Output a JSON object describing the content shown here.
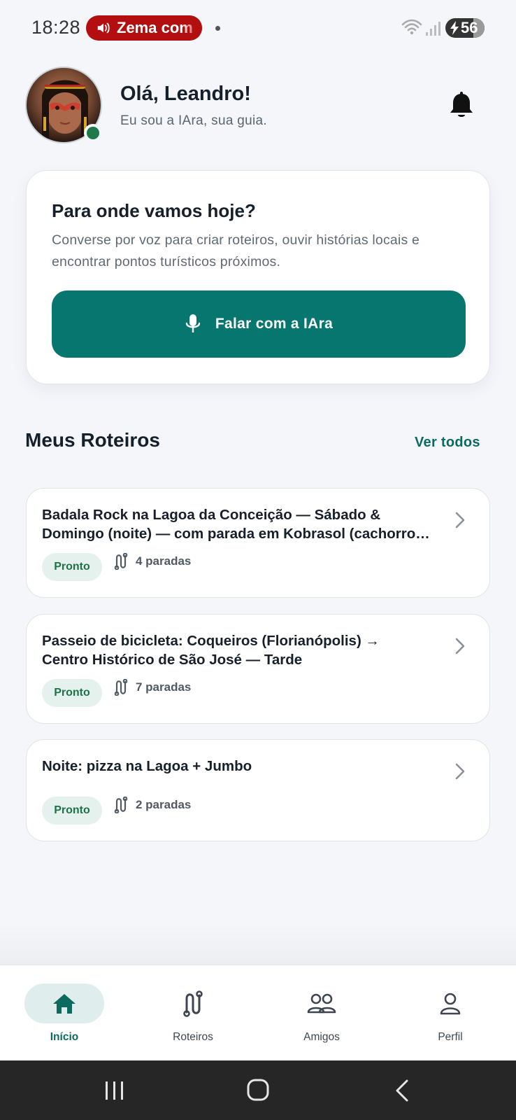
{
  "status_bar": {
    "time": "18:28",
    "media_label": "Zema com",
    "battery_level": "56",
    "icons": [
      "speaker-icon",
      "wifi-icon",
      "signal-icon",
      "battery-icon",
      "charging-bolt-icon"
    ]
  },
  "header": {
    "greeting": "Olá, Leandro!",
    "subtitle": "Eu sou a IAra, sua guia.",
    "status_color": "#1f7a4a"
  },
  "hero": {
    "title": "Para onde vamos hoje?",
    "description": "Converse por voz para criar roteiros, ouvir histórias locais e encontrar pontos turísticos próximos.",
    "button_label": "Falar com a IAra",
    "button_color": "#06766e"
  },
  "routes_section": {
    "title": "Meus Roteiros",
    "see_all": "Ver todos",
    "items": [
      {
        "title_line1": "Badala Rock na Lagoa da Conceição — Sábado &",
        "title_line2": "Domingo (noite) — com parada em Kobrasol (cachorro-quente)",
        "status": "Pronto",
        "stops": "4 paradas"
      },
      {
        "title_line1": "Passeio de bicicleta: Coqueiros (Florianópolis) →",
        "title_line2": "Centro Histórico de São José — Tarde",
        "status": "Pronto",
        "stops": "7 paradas"
      },
      {
        "title_line1": "Noite: pizza na Lagoa + Jumbo",
        "title_line2": "",
        "status": "Pronto",
        "stops": "2 paradas"
      }
    ]
  },
  "bottom_nav": {
    "items": [
      {
        "label": "Início",
        "icon": "home-icon",
        "active": true
      },
      {
        "label": "Roteiros",
        "icon": "route-icon",
        "active": false
      },
      {
        "label": "Amigos",
        "icon": "friends-icon",
        "active": false
      },
      {
        "label": "Perfil",
        "icon": "profile-icon",
        "active": false
      }
    ],
    "accent_color": "#0c6a61"
  },
  "system_nav": {
    "icons": [
      "recent-apps-icon",
      "home-button-icon",
      "back-icon"
    ]
  }
}
